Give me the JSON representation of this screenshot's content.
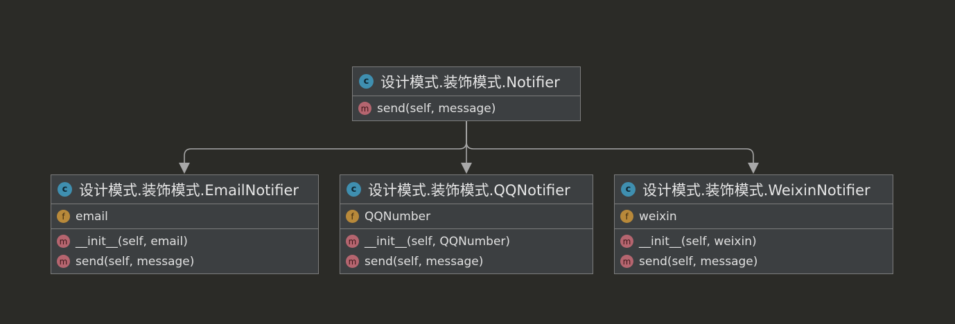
{
  "diagram": {
    "colors": {
      "background": "#2b2b27",
      "node_fill": "#3c3f41",
      "node_border": "#7d7d7d",
      "edge": "#a8a8a8",
      "class_icon": "#3f8fb0",
      "method_icon": "#b5656f",
      "field_icon": "#b8893a"
    },
    "icons": {
      "class": "c",
      "method": "m",
      "field": "f"
    },
    "classes": [
      {
        "id": "notifier",
        "name": "设计模式.装饰模式.Notifier",
        "fields": [],
        "methods": [
          "send(self, message)"
        ]
      },
      {
        "id": "email",
        "name": "设计模式.装饰模式.EmailNotifier",
        "fields": [
          "email"
        ],
        "methods": [
          "__init__(self, email)",
          "send(self, message)"
        ]
      },
      {
        "id": "qq",
        "name": "设计模式.装饰模式.QQNotifier",
        "fields": [
          "QQNumber"
        ],
        "methods": [
          "__init__(self, QQNumber)",
          "send(self, message)"
        ]
      },
      {
        "id": "weixin",
        "name": "设计模式.装饰模式.WeixinNotifier",
        "fields": [
          "weixin"
        ],
        "methods": [
          "__init__(self, weixin)",
          "send(self, message)"
        ]
      }
    ],
    "edges": [
      {
        "from": "notifier",
        "to": "email",
        "type": "inheritance"
      },
      {
        "from": "notifier",
        "to": "qq",
        "type": "inheritance"
      },
      {
        "from": "notifier",
        "to": "weixin",
        "type": "inheritance"
      }
    ]
  }
}
